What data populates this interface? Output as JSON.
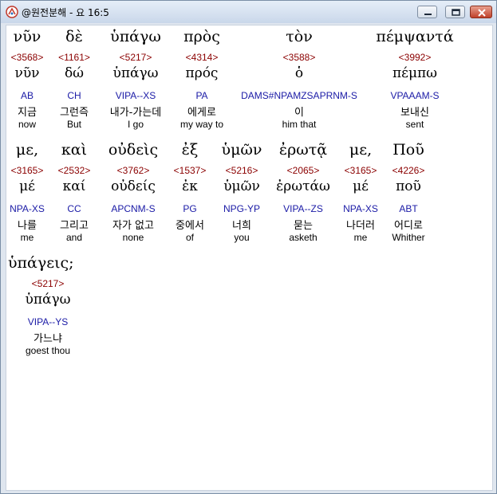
{
  "window": {
    "title": "@원전분해 - 요 16:5",
    "icon": "app-icon"
  },
  "rows": [
    [
      {
        "gk": "νῦν",
        "num": "<3568>",
        "lemma": "νῦν",
        "pars": "AB",
        "ko": "지금",
        "en": "now"
      },
      {
        "gk": "δὲ",
        "num": "<1161>",
        "lemma": "δώ",
        "pars": "CH",
        "ko": "그런즉",
        "en": "But"
      },
      {
        "gk": "ὑπάγω",
        "num": "<5217>",
        "lemma": "ὑπάγω",
        "pars": "VIPA--XS",
        "ko": "내가-가는데",
        "en": "I go"
      },
      {
        "gk": "πρὸς",
        "num": "<4314>",
        "lemma": "πρός",
        "pars": "PA",
        "ko": "에게로",
        "en": "my way to"
      },
      {
        "gk": "τὸν",
        "num": "<3588>",
        "lemma": "ὁ",
        "pars": "DAMS#NPAMZSAPRNM-S",
        "ko": "이",
        "en": "him that"
      },
      {
        "gk": "πέμψαντά",
        "num": "<3992>",
        "lemma": "πέμπω",
        "pars": "VPAAAM-S",
        "ko": "보내신",
        "en": "sent"
      }
    ],
    [
      {
        "gk": "με,",
        "num": "<3165>",
        "lemma": "μέ",
        "pars": "NPA-XS",
        "ko": "나를",
        "en": "me"
      },
      {
        "gk": "καὶ",
        "num": "<2532>",
        "lemma": "καί",
        "pars": "CC",
        "ko": "그리고",
        "en": "and"
      },
      {
        "gk": "οὐδεὶς",
        "num": "<3762>",
        "lemma": "οὐδείς",
        "pars": "APCNM-S",
        "ko": "자가 없고",
        "en": "none"
      },
      {
        "gk": "ἐξ",
        "num": "<1537>",
        "lemma": "ἐκ",
        "pars": "PG",
        "ko": "중에서",
        "en": "of"
      },
      {
        "gk": "ὑμῶν",
        "num": "<5216>",
        "lemma": "ὑμῶν",
        "pars": "NPG-YP",
        "ko": "너희",
        "en": "you"
      },
      {
        "gk": "ἐρωτᾷ",
        "num": "<2065>",
        "lemma": "ἐρωτάω",
        "pars": "VIPA--ZS",
        "ko": "묻는",
        "en": "asketh"
      },
      {
        "gk": "με,",
        "num": "<3165>",
        "lemma": "μέ",
        "pars": "NPA-XS",
        "ko": "나더러",
        "en": "me"
      },
      {
        "gk": "Ποῦ",
        "num": "<4226>",
        "lemma": "ποῦ",
        "pars": "ABT",
        "ko": "어디로",
        "en": "Whither"
      }
    ],
    [
      {
        "gk": "ὑπάγεις;",
        "num": "<5217>",
        "lemma": "ὑπάγω",
        "pars": "VIPA--YS",
        "ko": "가느냐",
        "en": "goest thou"
      }
    ]
  ]
}
